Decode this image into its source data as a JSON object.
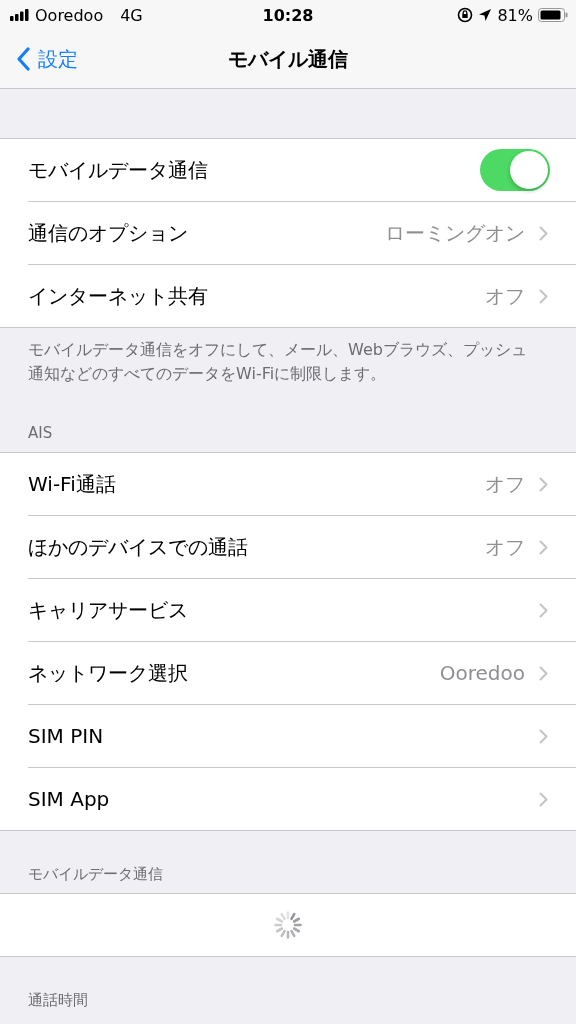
{
  "status_bar": {
    "carrier": "Ooredoo",
    "network": "4G",
    "time": "10:28",
    "battery": "81%"
  },
  "nav": {
    "back": "設定",
    "title": "モバイル通信"
  },
  "groups": [
    {
      "footer": "モバイルデータ通信をオフにして、メール、Webブラウズ、プッシュ通知などのすべてのデータをWi-Fiに制限します。",
      "rows": [
        {
          "kind": "toggle",
          "label": "モバイルデータ通信",
          "on": true
        },
        {
          "kind": "link",
          "label": "通信のオプション",
          "value": "ローミングオン"
        },
        {
          "kind": "link",
          "label": "インターネット共有",
          "value": "オフ"
        }
      ]
    },
    {
      "header": "AIS",
      "rows": [
        {
          "kind": "link",
          "label": "Wi-Fi通話",
          "value": "オフ"
        },
        {
          "kind": "link",
          "label": "ほかのデバイスでの通話",
          "value": "オフ"
        },
        {
          "kind": "link",
          "label": "キャリアサービス"
        },
        {
          "kind": "link",
          "label": "ネットワーク選択",
          "value": "Ooredoo"
        },
        {
          "kind": "link",
          "label": "SIM PIN"
        },
        {
          "kind": "link",
          "label": "SIM App"
        }
      ]
    },
    {
      "header": "モバイルデータ通信",
      "rows": [
        {
          "kind": "spinner"
        }
      ]
    },
    {
      "header": "通話時間"
    }
  ]
}
